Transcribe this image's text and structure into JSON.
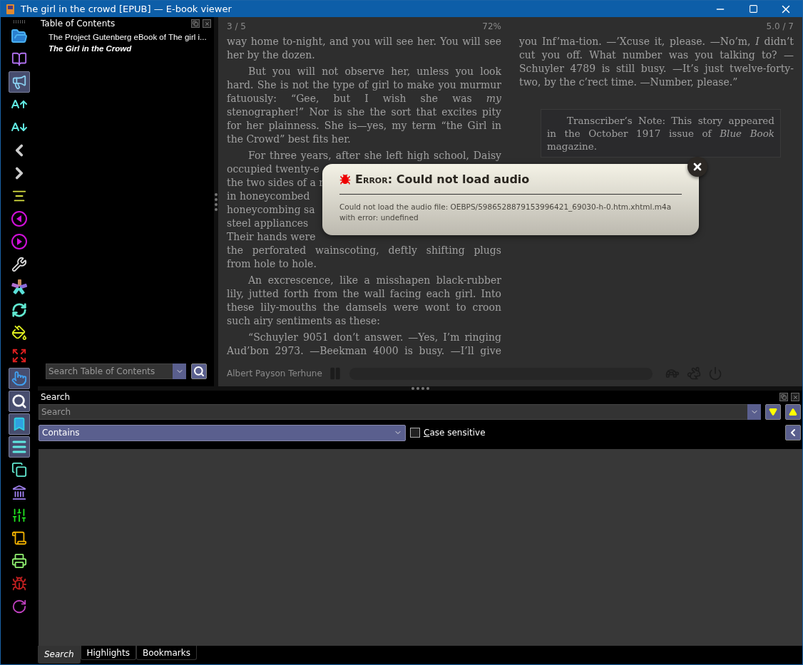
{
  "window": {
    "title": "The girl in the crowd [EPUB] — E-book viewer"
  },
  "toolbar": [
    {
      "kind": "open",
      "highlighted": false
    },
    {
      "kind": "book",
      "highlighted": false
    },
    {
      "kind": "read-aloud",
      "highlighted": true
    },
    {
      "kind": "font-up",
      "highlighted": false
    },
    {
      "kind": "font-down",
      "highlighted": false
    },
    {
      "kind": "back",
      "highlighted": false
    },
    {
      "kind": "forward",
      "highlighted": false
    },
    {
      "kind": "toc",
      "highlighted": false
    },
    {
      "kind": "prev",
      "highlighted": false
    },
    {
      "kind": "next",
      "highlighted": false
    },
    {
      "kind": "tools",
      "highlighted": false
    },
    {
      "kind": "spark",
      "highlighted": false
    },
    {
      "kind": "sync",
      "highlighted": false
    },
    {
      "kind": "paint",
      "highlighted": false
    },
    {
      "kind": "fullscreen",
      "highlighted": false
    },
    {
      "kind": "hand",
      "highlighted": true
    },
    {
      "kind": "search",
      "highlighted": true
    },
    {
      "kind": "bookmark",
      "highlighted": true
    },
    {
      "kind": "menu",
      "highlighted": true
    },
    {
      "kind": "copy",
      "highlighted": false
    },
    {
      "kind": "library",
      "highlighted": false
    },
    {
      "kind": "sliders",
      "highlighted": false
    },
    {
      "kind": "scroll",
      "highlighted": false
    },
    {
      "kind": "print",
      "highlighted": false
    },
    {
      "kind": "bug",
      "highlighted": false
    },
    {
      "kind": "reload",
      "highlighted": false
    }
  ],
  "toc": {
    "title": "Table of Contents",
    "items": [
      {
        "label": "The Project Gutenberg eBook of The girl i...",
        "selected": false
      },
      {
        "label": "The Girl in the Crowd",
        "selected": true
      }
    ],
    "search": {
      "placeholder": "Search Table of Contents"
    }
  },
  "reader": {
    "left_info": "3 / 5",
    "progress": "72%",
    "right_info": "5.0 / 7",
    "author": "Albert Payson Terhune",
    "columns": [
      [
        {
          "kind": "para",
          "indent": false,
          "continues": false,
          "text": "way home to-night, and you will see her. You will see her by the dozen."
        },
        {
          "kind": "para",
          "indent": true,
          "continues": false,
          "text": "But you will not observe her, unless you look hard. She is not the type of girl to make you murmur fatuously: “Gee, but I wish she was *my* stenographer!” Nor is she the sort that excites pity for her plainness. She is—yes, my term “the Girl in the Crowd” best fits her."
        },
        {
          "kind": "lines",
          "lines": [
            {
              "text": "For three years, after she left high school, Daisy",
              "full": true
            },
            {
              "text": "occupied twenty-e",
              "full": false
            },
            {
              "text": "the two sides of a r",
              "full": false
            },
            {
              "text": "in honeycombed",
              "full": false
            },
            {
              "text": "honeycombing sa",
              "full": false
            },
            {
              "text": "steel appliances",
              "full": false
            },
            {
              "text": "Their hands were",
              "full": false
            },
            {
              "text": "the perforated wainscoting, deftly shifting plugs",
              "full": true
            },
            {
              "text": "from hole to hole.",
              "full": false
            }
          ]
        },
        {
          "kind": "para",
          "indent": true,
          "continues": false,
          "text": "An excrescence, like a misshapen black-rubber lily, jutted forth from the wall facing each girl. Into these lily-mouths the damsels were wont to croon such airy sentiments as these:"
        },
        {
          "kind": "para",
          "indent": true,
          "continues": true,
          "text": "“Schuyler 9051 don’t answer. —Yes, I’m ringing Aud’bon 2973. —Beekman 4000 is busy. —I’ll give"
        }
      ],
      [
        {
          "kind": "para",
          "indent": false,
          "continues": false,
          "text": "you Inf’ma-tion. —’Xcuse it, please. —No’m, *I* didn’t cut you off. What number was you talking to? —Schuyler 4789 is still busy. —It’s just twelve-forty-two, by the c’rect time. —Number, please.”"
        },
        {
          "kind": "note",
          "text": "Transcriber’s Note: This story appeared in the October 1917 issue of *Blue Book* magazine."
        }
      ]
    ]
  },
  "dialog": {
    "title_prefix": "Error:",
    "title": "Could not load audio",
    "message_lines": [
      "Could not load the audio file: OEBPS/5986528879153996421_69030-h-0.htm.xhtml.m4a",
      "with error: undefined"
    ]
  },
  "search_panel": {
    "title": "Search",
    "search": {
      "placeholder": "Search"
    },
    "mode": "Contains",
    "case_sensitive": {
      "label": "Case sensitive",
      "checked": false
    }
  },
  "bottom_tabs": [
    {
      "label": "Search",
      "selected": true
    },
    {
      "label": "Highlights",
      "selected": false
    },
    {
      "label": "Bookmarks",
      "selected": false
    }
  ]
}
